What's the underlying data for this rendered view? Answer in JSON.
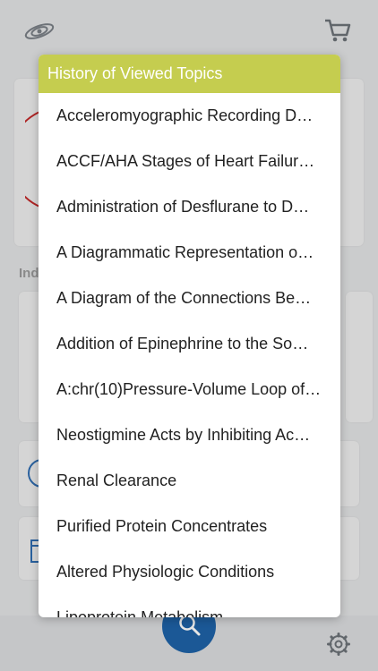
{
  "background": {
    "section_label": "Ind"
  },
  "modal": {
    "title": "History of Viewed Topics",
    "items": [
      "Acceleromyographic Recording D…",
      "ACCF/AHA Stages of Heart Failur…",
      "Administration of Desflurane to D…",
      "A Diagrammatic Representation o…",
      "A Diagram of the Connections Be…",
      "Addition of Epinephrine to the So…",
      "A:chr(10)Pressure-Volume Loop of…",
      "Neostigmine Acts by Inhibiting Ac…",
      "Renal Clearance",
      "Purified Protein Concentrates",
      "Altered Physiologic Conditions",
      "Lipoprotein Metabolism"
    ]
  },
  "colors": {
    "header_bg": "#c5cd4f",
    "fab_bg": "#1f63a7"
  },
  "icons": {
    "logo": "galaxy-logo-icon",
    "cart": "cart-icon",
    "search": "search-icon",
    "settings": "gear-icon"
  }
}
